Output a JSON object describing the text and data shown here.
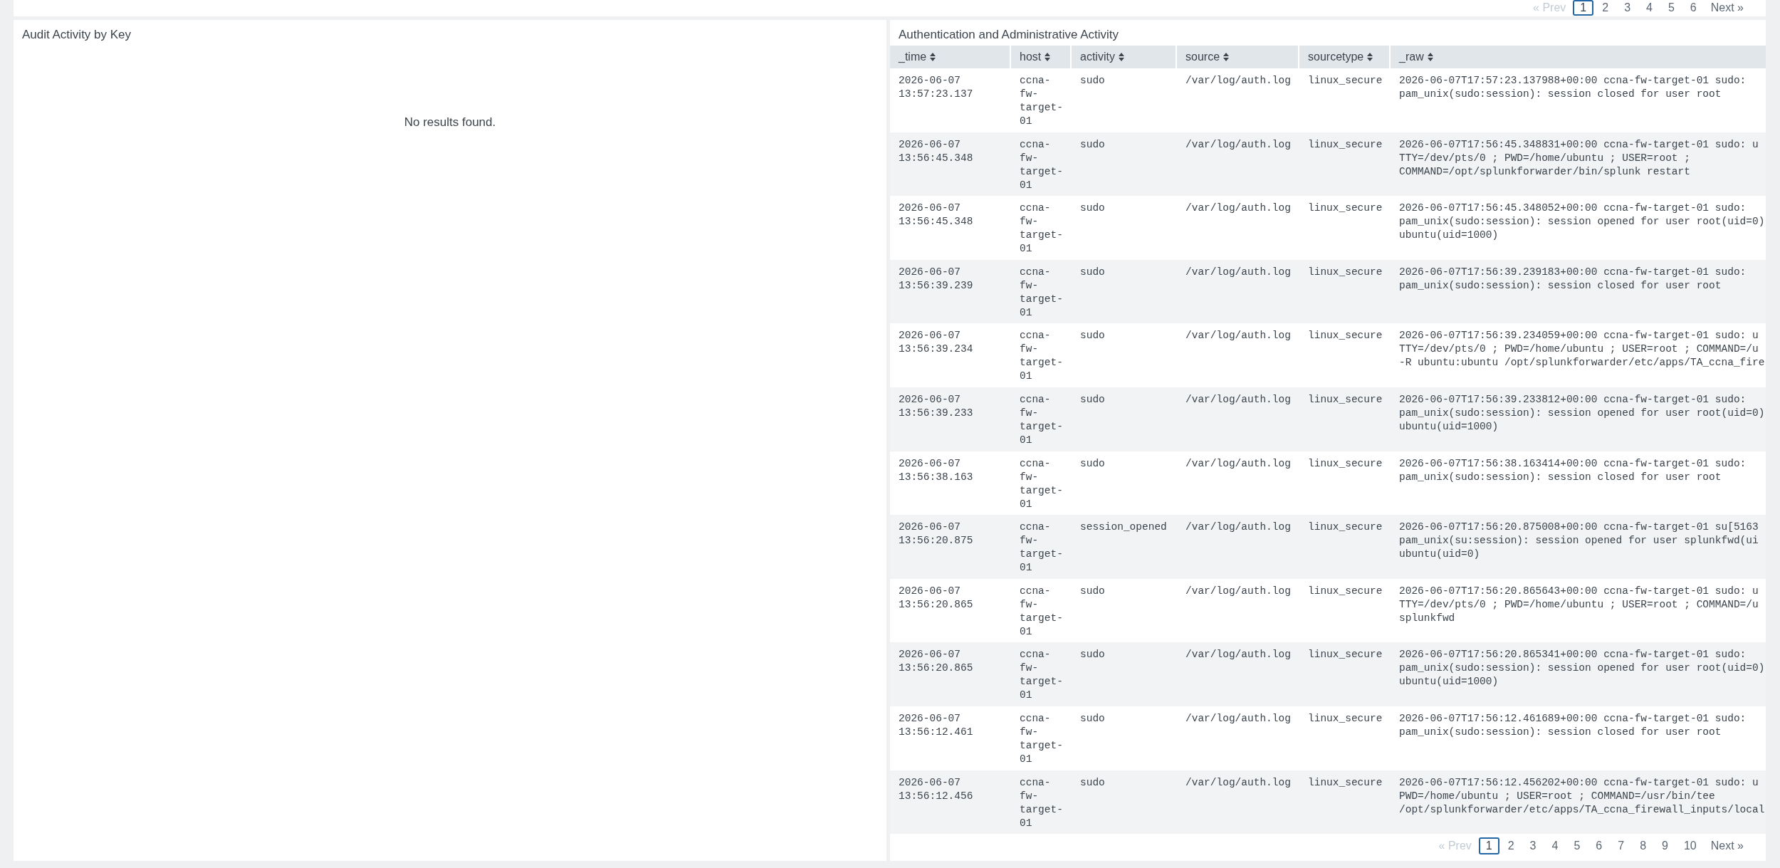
{
  "top_panel": {
    "pagination": {
      "prev": {
        "label": "« Prev",
        "disabled": true
      },
      "pages": [
        {
          "label": "1",
          "selected": true
        },
        {
          "label": "2",
          "selected": false
        },
        {
          "label": "3",
          "selected": false
        },
        {
          "label": "4",
          "selected": false
        },
        {
          "label": "5",
          "selected": false
        },
        {
          "label": "6",
          "selected": false
        }
      ],
      "next": {
        "label": "Next »",
        "disabled": false
      }
    }
  },
  "panels": [
    {
      "kind": "message",
      "title": "Audit Activity by Key",
      "message": "No results found."
    },
    {
      "kind": "table",
      "title": "Authentication and Administrative Activity",
      "table": {
        "columns": [
          "_time",
          "host",
          "activity",
          "source",
          "sourcetype",
          "_raw"
        ],
        "rows": [
          [
            "2026-06-07 13:57:23.137",
            "ccna-fw-target-01",
            "sudo",
            "/var/log/auth.log",
            "linux_secure",
            "2026-06-07T17:57:23.137988+00:00 ccna-fw-target-01 sudo:\npam_unix(sudo:session): session closed for user root"
          ],
          [
            "2026-06-07 13:56:45.348",
            "ccna-fw-target-01",
            "sudo",
            "/var/log/auth.log",
            "linux_secure",
            "2026-06-07T17:56:45.348831+00:00 ccna-fw-target-01 sudo: u\nTTY=/dev/pts/0 ; PWD=/home/ubuntu ; USER=root ;\nCOMMAND=/opt/splunkforwarder/bin/splunk restart"
          ],
          [
            "2026-06-07 13:56:45.348",
            "ccna-fw-target-01",
            "sudo",
            "/var/log/auth.log",
            "linux_secure",
            "2026-06-07T17:56:45.348052+00:00 ccna-fw-target-01 sudo:\npam_unix(sudo:session): session opened for user root(uid=0)\nubuntu(uid=1000)"
          ],
          [
            "2026-06-07 13:56:39.239",
            "ccna-fw-target-01",
            "sudo",
            "/var/log/auth.log",
            "linux_secure",
            "2026-06-07T17:56:39.239183+00:00 ccna-fw-target-01 sudo:\npam_unix(sudo:session): session closed for user root"
          ],
          [
            "2026-06-07 13:56:39.234",
            "ccna-fw-target-01",
            "sudo",
            "/var/log/auth.log",
            "linux_secure",
            "2026-06-07T17:56:39.234059+00:00 ccna-fw-target-01 sudo: u\nTTY=/dev/pts/0 ; PWD=/home/ubuntu ; USER=root ; COMMAND=/u\n-R ubuntu:ubuntu /opt/splunkforwarder/etc/apps/TA_ccna_fire"
          ],
          [
            "2026-06-07 13:56:39.233",
            "ccna-fw-target-01",
            "sudo",
            "/var/log/auth.log",
            "linux_secure",
            "2026-06-07T17:56:39.233812+00:00 ccna-fw-target-01 sudo:\npam_unix(sudo:session): session opened for user root(uid=0)\nubuntu(uid=1000)"
          ],
          [
            "2026-06-07 13:56:38.163",
            "ccna-fw-target-01",
            "sudo",
            "/var/log/auth.log",
            "linux_secure",
            "2026-06-07T17:56:38.163414+00:00 ccna-fw-target-01 sudo:\npam_unix(sudo:session): session closed for user root"
          ],
          [
            "2026-06-07 13:56:20.875",
            "ccna-fw-target-01",
            "session_opened",
            "/var/log/auth.log",
            "linux_secure",
            "2026-06-07T17:56:20.875008+00:00 ccna-fw-target-01 su[5163\npam_unix(su:session): session opened for user splunkfwd(ui\nubuntu(uid=0)"
          ],
          [
            "2026-06-07 13:56:20.865",
            "ccna-fw-target-01",
            "sudo",
            "/var/log/auth.log",
            "linux_secure",
            "2026-06-07T17:56:20.865643+00:00 ccna-fw-target-01 sudo: u\nTTY=/dev/pts/0 ; PWD=/home/ubuntu ; USER=root ; COMMAND=/u\nsplunkfwd"
          ],
          [
            "2026-06-07 13:56:20.865",
            "ccna-fw-target-01",
            "sudo",
            "/var/log/auth.log",
            "linux_secure",
            "2026-06-07T17:56:20.865341+00:00 ccna-fw-target-01 sudo:\npam_unix(sudo:session): session opened for user root(uid=0)\nubuntu(uid=1000)"
          ],
          [
            "2026-06-07 13:56:12.461",
            "ccna-fw-target-01",
            "sudo",
            "/var/log/auth.log",
            "linux_secure",
            "2026-06-07T17:56:12.461689+00:00 ccna-fw-target-01 sudo:\npam_unix(sudo:session): session closed for user root"
          ],
          [
            "2026-06-07 13:56:12.456",
            "ccna-fw-target-01",
            "sudo",
            "/var/log/auth.log",
            "linux_secure",
            "2026-06-07T17:56:12.456202+00:00 ccna-fw-target-01 sudo: u\nPWD=/home/ubuntu ; USER=root ; COMMAND=/usr/bin/tee\n/opt/splunkforwarder/etc/apps/TA_ccna_firewall_inputs/local"
          ]
        ]
      },
      "pagination": {
        "prev": {
          "label": "« Prev",
          "disabled": true
        },
        "pages": [
          {
            "label": "1",
            "selected": true
          },
          {
            "label": "2",
            "selected": false
          },
          {
            "label": "3",
            "selected": false
          },
          {
            "label": "4",
            "selected": false
          },
          {
            "label": "5",
            "selected": false
          },
          {
            "label": "6",
            "selected": false
          },
          {
            "label": "7",
            "selected": false
          },
          {
            "label": "8",
            "selected": false
          },
          {
            "label": "9",
            "selected": false
          },
          {
            "label": "10",
            "selected": false
          }
        ],
        "next": {
          "label": "Next »",
          "disabled": false
        }
      }
    }
  ]
}
